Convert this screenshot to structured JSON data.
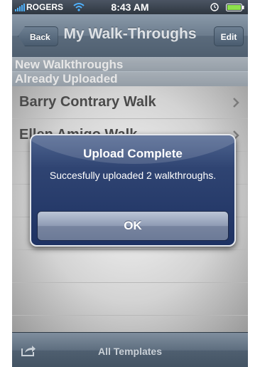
{
  "status_bar": {
    "carrier": "ROGERS",
    "time": "8:43 AM"
  },
  "nav": {
    "back_label": "Back",
    "title": "My Walk-Throughs",
    "edit_label": "Edit"
  },
  "sections": {
    "new": "New Walkthroughs",
    "uploaded": "Already Uploaded"
  },
  "rows": [
    {
      "label": "Barry Contrary Walk"
    },
    {
      "label": "Ellen Amigo Walk"
    }
  ],
  "toolbar": {
    "label": "All Templates"
  },
  "alert": {
    "title": "Upload Complete",
    "message": "Succesfully uploaded 2 walkthroughs.",
    "ok_label": "OK"
  },
  "colors": {
    "nav_bar": "#6c7c8d",
    "alert_background": "#2f4472",
    "row_text": "#4a4a4a"
  },
  "icons": [
    "signal-icon",
    "wifi-icon",
    "lock-icon",
    "battery-icon",
    "chevron-icon",
    "share-icon"
  ]
}
